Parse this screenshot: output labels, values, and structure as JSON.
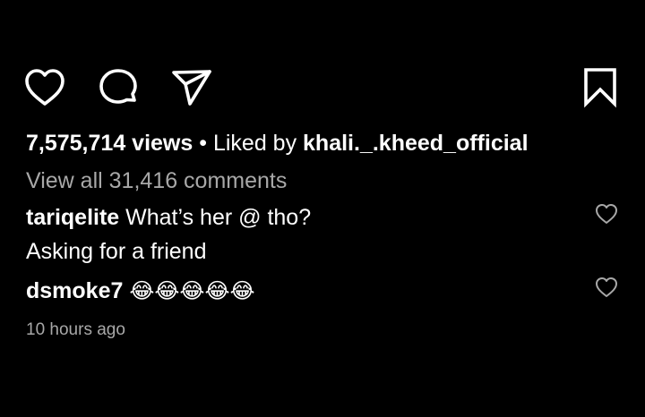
{
  "post": {
    "views": "7,575,714 views",
    "separator": "•",
    "liked_by_prefix": "Liked by",
    "liked_by_user": "khali._.kheed_official",
    "view_all_comments": "View all 31,416 comments",
    "timestamp": "10 hours ago"
  },
  "actions": {
    "like_icon": "heart-outline-icon",
    "comment_icon": "speech-bubble-icon",
    "share_icon": "paper-plane-icon",
    "save_icon": "bookmark-icon"
  },
  "comments": [
    {
      "username": "tariqelite",
      "text": "What’s her @ tho?",
      "text_line2": "Asking for a friend"
    },
    {
      "username": "dsmoke7",
      "text": "😂😂😂😂😂"
    }
  ],
  "colors": {
    "background": "#000000",
    "text_primary": "#ffffff",
    "text_secondary": "#a8a8a8"
  }
}
